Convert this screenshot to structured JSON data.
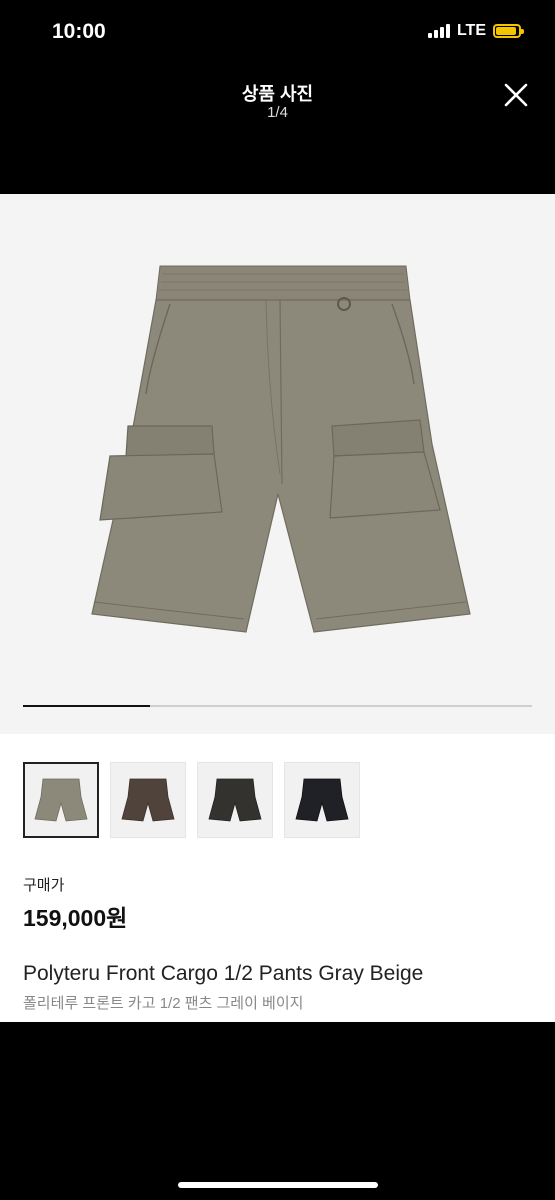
{
  "status_bar": {
    "time": "10:00",
    "network": "LTE",
    "signal_icon": "cell-signal-icon",
    "battery_icon": "battery-icon",
    "battery_color": "#f5c400"
  },
  "header": {
    "title": "상품 사진",
    "counter": "1/4",
    "close_icon": "close-icon"
  },
  "gallery": {
    "progress_fraction": 0.25,
    "thumbnails": [
      {
        "label": "Gray Beige",
        "color": "#8d897a"
      },
      {
        "label": "Brown",
        "color": "#4f433c"
      },
      {
        "label": "Charcoal",
        "color": "#33322f"
      },
      {
        "label": "Black",
        "color": "#1f2126"
      }
    ],
    "main_photo_color": "#8d897a"
  },
  "product": {
    "price_label": "구매가",
    "price": "159,000원",
    "name_en": "Polyteru Front Cargo 1/2 Pants Gray Beige",
    "name_ko": "폴리테루 프론트 카고 1/2 팬츠 그레이 베이지"
  },
  "colors": {
    "background": "#000000",
    "content_bg": "#ffffff",
    "photo_bg": "#f4f4f4"
  }
}
